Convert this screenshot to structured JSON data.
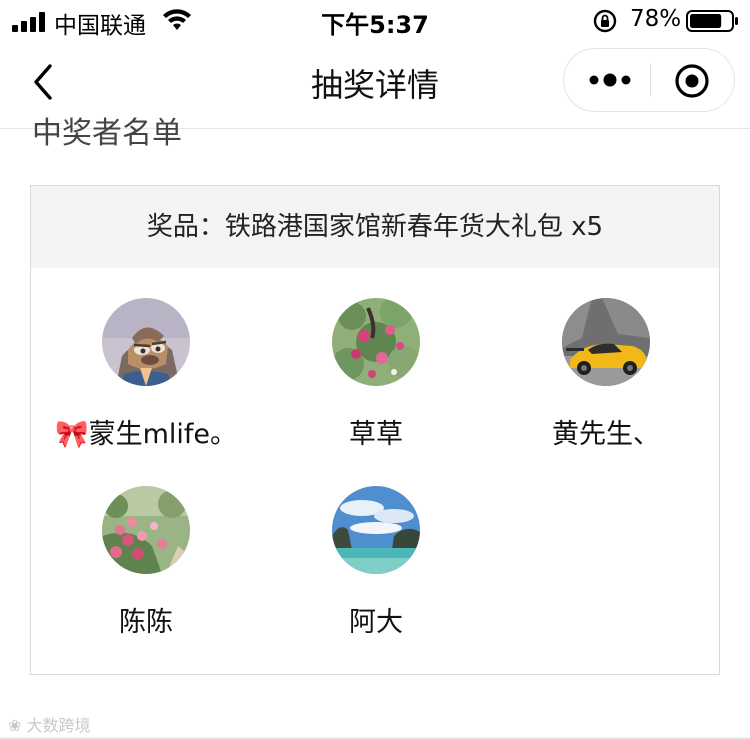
{
  "status_bar": {
    "carrier": "中国联通",
    "time": "下午5:37",
    "battery": "78%",
    "battery_level": 0.78
  },
  "nav": {
    "title": "抽奖详情"
  },
  "section": {
    "title": "中奖者名单"
  },
  "prize": {
    "label": "奖品：铁路港国家馆新春年货大礼包 x5"
  },
  "winners": [
    {
      "name": "🎀蒙生mlife。",
      "avatar": "cartoon-fox-avatar"
    },
    {
      "name": "草草",
      "avatar": "pink-flowers-avatar"
    },
    {
      "name": "黄先生、",
      "avatar": "yellow-sports-car-avatar"
    },
    {
      "name": "陈陈",
      "avatar": "flower-garden-avatar"
    },
    {
      "name": "阿大",
      "avatar": "sky-sea-avatar"
    }
  ],
  "watermark": "大数跨境",
  "colors": {
    "nav_text": "#111111",
    "prize_header_bg": "#f4f4f4",
    "card_border": "#d9d9d9"
  }
}
